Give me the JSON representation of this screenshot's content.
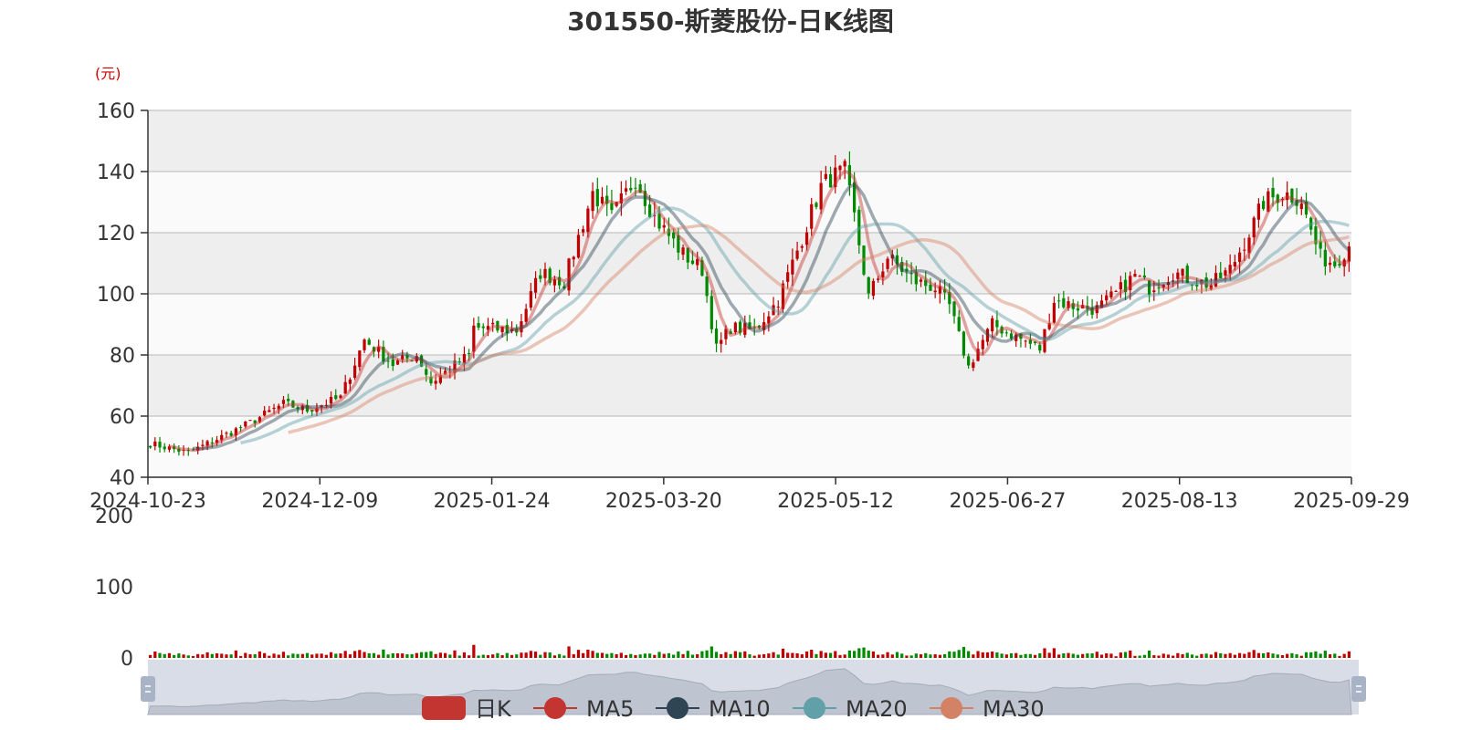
{
  "chart_data": {
    "type": "candlestick",
    "title": "301550-斯菱股份-日K线图",
    "y_unit": "(元)",
    "price_axis": {
      "ylim": [
        40,
        160
      ],
      "ticks": [
        40,
        60,
        80,
        100,
        120,
        140,
        160
      ],
      "grid": true,
      "banded": true
    },
    "volume_axis": {
      "ylim": [
        0,
        200
      ],
      "ticks": [
        0,
        100,
        200
      ]
    },
    "x_ticks": [
      "2024-10-23",
      "2024-12-09",
      "2025-01-24",
      "2025-03-20",
      "2025-05-12",
      "2025-06-27",
      "2025-08-13",
      "2025-09-29"
    ],
    "legend": {
      "position": "bottom",
      "items": [
        {
          "name": "日K",
          "color": "#c23531"
        },
        {
          "name": "MA5",
          "color": "#c23531"
        },
        {
          "name": "MA10",
          "color": "#2f4554"
        },
        {
          "name": "MA20",
          "color": "#61a0a8"
        },
        {
          "name": "MA30",
          "color": "#d48265"
        }
      ]
    },
    "colors": {
      "up": "#c00000",
      "down": "#008a00"
    },
    "price_keypoints": [
      [
        "2024-10-23",
        51
      ],
      [
        "2024-11-04",
        48
      ],
      [
        "2024-11-20",
        57
      ],
      [
        "2024-12-02",
        64
      ],
      [
        "2024-12-09",
        62
      ],
      [
        "2024-12-18",
        66
      ],
      [
        "2024-12-25",
        85
      ],
      [
        "2025-01-02",
        77
      ],
      [
        "2025-01-09",
        80
      ],
      [
        "2025-01-14",
        71
      ],
      [
        "2025-01-24",
        80
      ],
      [
        "2025-01-27",
        89
      ],
      [
        "2025-02-07",
        88
      ],
      [
        "2025-02-14",
        107
      ],
      [
        "2025-02-21",
        104
      ],
      [
        "2025-03-03",
        133
      ],
      [
        "2025-03-07",
        125
      ],
      [
        "2025-03-14",
        138
      ],
      [
        "2025-03-20",
        125
      ],
      [
        "2025-03-28",
        113
      ],
      [
        "2025-04-03",
        108
      ],
      [
        "2025-04-08",
        82
      ],
      [
        "2025-04-11",
        89
      ],
      [
        "2025-04-18",
        88
      ],
      [
        "2025-04-25",
        98
      ],
      [
        "2025-04-30",
        110
      ],
      [
        "2025-05-08",
        135
      ],
      [
        "2025-05-12",
        138
      ],
      [
        "2025-05-15",
        140
      ],
      [
        "2025-05-19",
        125
      ],
      [
        "2025-05-22",
        99
      ],
      [
        "2025-05-28",
        112
      ],
      [
        "2025-06-05",
        104
      ],
      [
        "2025-06-11",
        102
      ],
      [
        "2025-06-16",
        96
      ],
      [
        "2025-06-20",
        76
      ],
      [
        "2025-06-24",
        82
      ],
      [
        "2025-06-27",
        90
      ],
      [
        "2025-07-04",
        86
      ],
      [
        "2025-07-11",
        82
      ],
      [
        "2025-07-16",
        98
      ],
      [
        "2025-07-22",
        96
      ],
      [
        "2025-07-29",
        95
      ],
      [
        "2025-08-04",
        100
      ],
      [
        "2025-08-08",
        106
      ],
      [
        "2025-08-13",
        102
      ],
      [
        "2025-08-20",
        107
      ],
      [
        "2025-08-27",
        104
      ],
      [
        "2025-09-01",
        103
      ],
      [
        "2025-09-05",
        108
      ],
      [
        "2025-09-12",
        123
      ],
      [
        "2025-09-16",
        130
      ],
      [
        "2025-09-22",
        133
      ],
      [
        "2025-09-26",
        131
      ],
      [
        "2025-09-29",
        125
      ],
      [
        "2025-10-02",
        112
      ],
      [
        "2025-10-07",
        110
      ],
      [
        "2025-10-10",
        116
      ]
    ]
  }
}
